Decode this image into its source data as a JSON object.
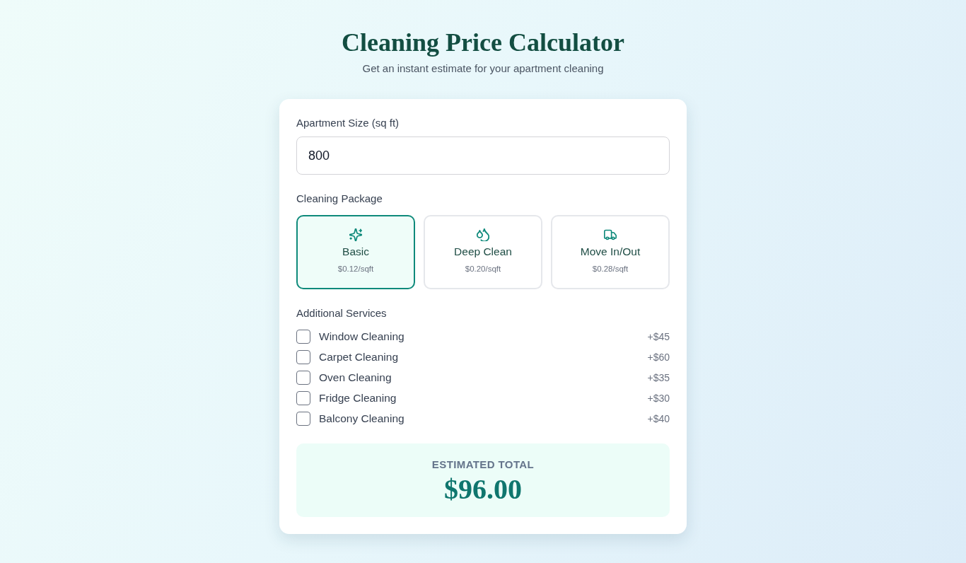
{
  "header": {
    "title": "Cleaning Price Calculator",
    "subtitle": "Get an instant estimate for your apartment cleaning"
  },
  "size_field": {
    "label": "Apartment Size (sq ft)",
    "value": "800"
  },
  "packages": {
    "label": "Cleaning Package",
    "options": [
      {
        "name": "Basic",
        "price": "$0.12/sqft",
        "selected": true
      },
      {
        "name": "Deep Clean",
        "price": "$0.20/sqft",
        "selected": false
      },
      {
        "name": "Move In/Out",
        "price": "$0.28/sqft",
        "selected": false
      }
    ]
  },
  "services": {
    "label": "Additional Services",
    "items": [
      {
        "label": "Window Cleaning",
        "price": "+$45",
        "checked": false
      },
      {
        "label": "Carpet Cleaning",
        "price": "+$60",
        "checked": false
      },
      {
        "label": "Oven Cleaning",
        "price": "+$35",
        "checked": false
      },
      {
        "label": "Fridge Cleaning",
        "price": "+$30",
        "checked": false
      },
      {
        "label": "Balcony Cleaning",
        "price": "+$40",
        "checked": false
      }
    ]
  },
  "total": {
    "label": "ESTIMATED TOTAL",
    "amount": "$96.00"
  }
}
